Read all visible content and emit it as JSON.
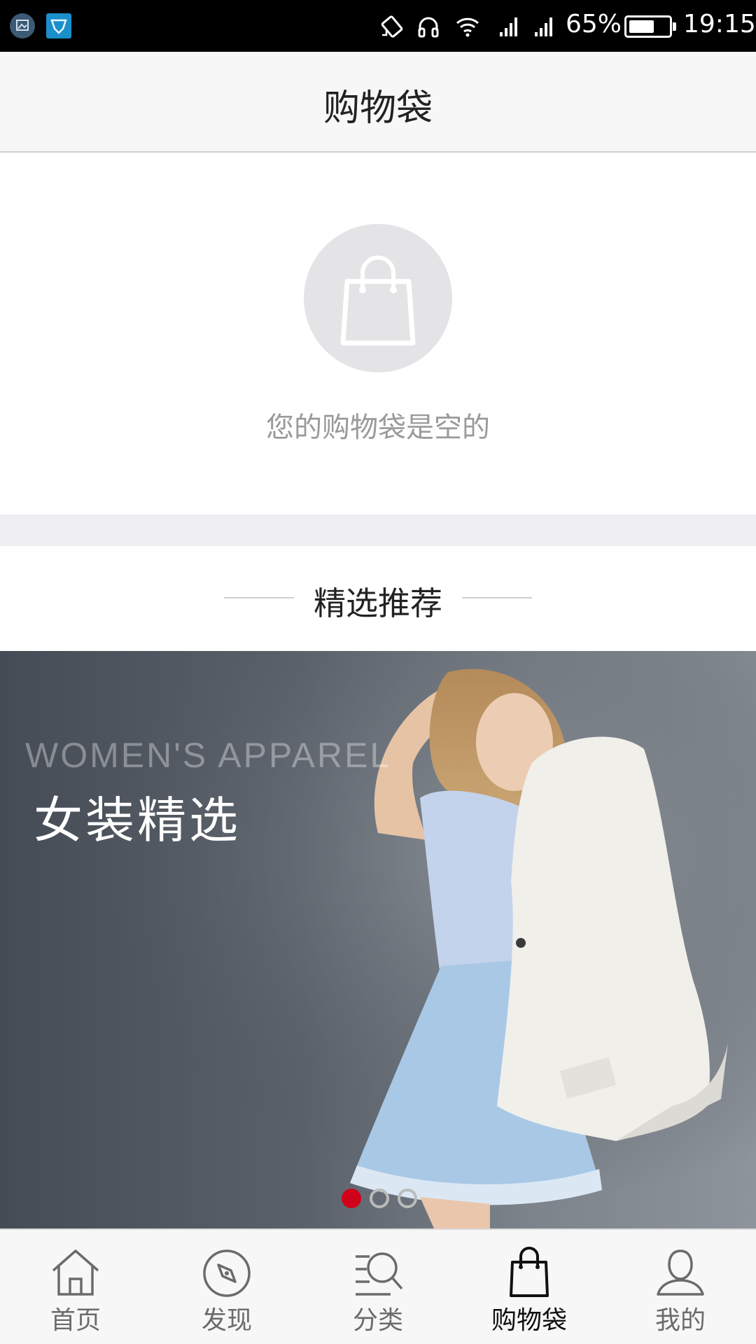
{
  "status_bar": {
    "battery_percent": "65%",
    "battery_level": 0.65,
    "time": "19:15",
    "icons": [
      "gallery-app-icon",
      "shield-app-icon",
      "rotate-icon",
      "headset-icon",
      "wifi-icon",
      "signal-icon",
      "signal-icon"
    ]
  },
  "header": {
    "title": "购物袋"
  },
  "empty_cart": {
    "icon": "shopping-bag-icon",
    "message": "您的购物袋是空的"
  },
  "recommend": {
    "heading": "精选推荐"
  },
  "banner": {
    "english_title": "WOMEN'S APPAREL",
    "chinese_title": "女装精选",
    "active_index": 0,
    "total_slides": 3,
    "indicator_active_color": "#d0021b"
  },
  "bottom_nav": {
    "items": [
      {
        "label": "首页",
        "icon": "home-icon"
      },
      {
        "label": "发现",
        "icon": "compass-icon"
      },
      {
        "label": "分类",
        "icon": "category-search-icon"
      },
      {
        "label": "购物袋",
        "icon": "shopping-bag-icon",
        "active": true
      },
      {
        "label": "我的",
        "icon": "profile-icon"
      }
    ]
  }
}
